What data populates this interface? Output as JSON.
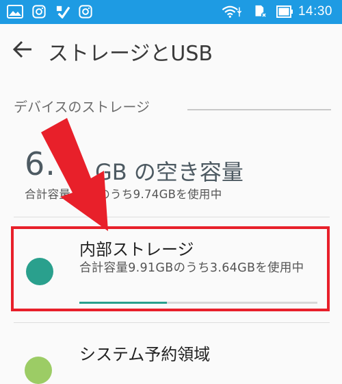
{
  "status_bar": {
    "time": "14:30",
    "icons": [
      "image-icon",
      "instagram-icon",
      "checkmark-app-icon",
      "instagram-icon",
      "wifi-icon",
      "sd-card-icon",
      "battery-icon"
    ],
    "color": "#1e9be3"
  },
  "app_bar": {
    "back_icon": "back-arrow-icon",
    "title": "ストレージとUSB"
  },
  "device_storage": {
    "section_header": "デバイスのストレージ",
    "free_amount": "6.",
    "free_label": "GB の空き容量",
    "summary": "合計容量 0GBのうち9.74GBを使用中"
  },
  "internal_storage": {
    "title": "内部ストレージ",
    "subtitle": "合計容量9.91GBのうち3.64GBを使用中",
    "usage_fraction": 0.367,
    "dot_color": "#2aa08d",
    "highlight_color": "#e8202a"
  },
  "system_reserved": {
    "title": "システム予約領域"
  },
  "annotation": {
    "arrow_color": "#e8202a",
    "arrow_icon": "red-arrow-icon"
  }
}
